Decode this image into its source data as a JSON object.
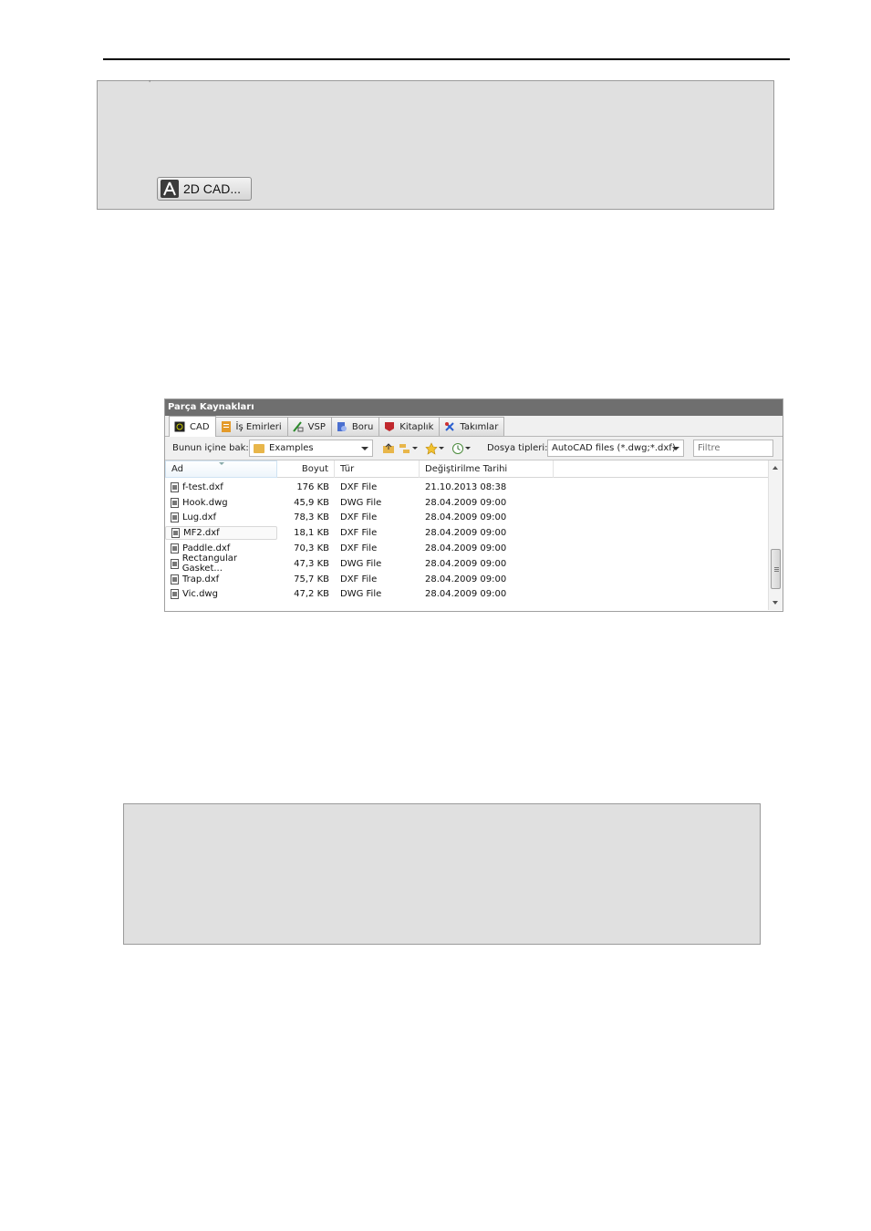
{
  "box1": {
    "tick": "'",
    "button_label": "2D CAD..."
  },
  "panel": {
    "title": "Parça Kaynakları",
    "tabs": [
      {
        "label": "CAD",
        "icon": "cad-icon"
      },
      {
        "label": "İş Emirleri",
        "icon": "work-order-icon"
      },
      {
        "label": "VSP",
        "icon": "vsp-icon"
      },
      {
        "label": "Boru",
        "icon": "pipe-icon"
      },
      {
        "label": "Kitaplık",
        "icon": "library-icon"
      },
      {
        "label": "Takımlar",
        "icon": "tools-icon"
      }
    ],
    "toolbar": {
      "look_in_label": "Bunun içine bak:",
      "look_in_value": "Examples",
      "file_types_label": "Dosya tipleri:",
      "file_types_value": "AutoCAD files (*.dwg;*.dxf)",
      "filter_placeholder": "Filtre"
    },
    "columns": {
      "name": "Ad",
      "size": "Boyut",
      "type": "Tür",
      "date": "Değiştirilme Tarihi"
    },
    "files": [
      {
        "name": "f-test.dxf",
        "size": "176 KB",
        "type": "DXF File",
        "date": "21.10.2013 08:38"
      },
      {
        "name": "Hook.dwg",
        "size": "45,9 KB",
        "type": "DWG File",
        "date": "28.04.2009 09:00"
      },
      {
        "name": "Lug.dxf",
        "size": "78,3 KB",
        "type": "DXF File",
        "date": "28.04.2009 09:00"
      },
      {
        "name": "MF2.dxf",
        "size": "18,1 KB",
        "type": "DXF File",
        "date": "28.04.2009 09:00"
      },
      {
        "name": "Paddle.dxf",
        "size": "70,3 KB",
        "type": "DXF File",
        "date": "28.04.2009 09:00"
      },
      {
        "name": "Rectangular Gasket...",
        "size": "47,3 KB",
        "type": "DWG File",
        "date": "28.04.2009 09:00"
      },
      {
        "name": "Trap.dxf",
        "size": "75,7 KB",
        "type": "DXF File",
        "date": "28.04.2009 09:00"
      },
      {
        "name": "Vic.dwg",
        "size": "47,2 KB",
        "type": "DWG File",
        "date": "28.04.2009 09:00"
      }
    ]
  }
}
